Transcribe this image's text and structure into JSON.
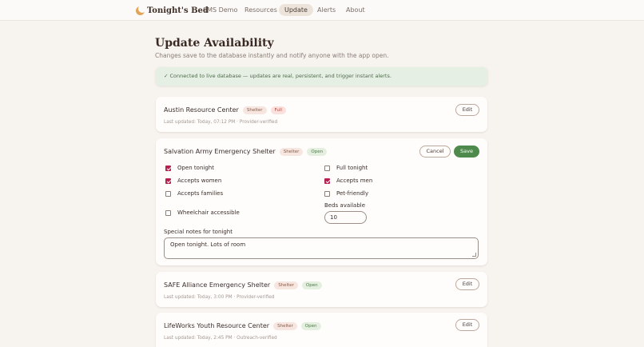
{
  "nav": {
    "brand": "Tonight's Bed",
    "items": [
      "SMS Demo",
      "Resources",
      "Update",
      "Alerts",
      "About"
    ],
    "active": "Update"
  },
  "page": {
    "title": "Update Availability",
    "subtitle": "Changes save to the database instantly and notify anyone with the app open."
  },
  "banner": {
    "text": "✓ Connected to live database — updates are real, persistent, and trigger instant alerts."
  },
  "cards": [
    {
      "name": "Austin Resource Center",
      "type": "Shelter",
      "status": "Full",
      "meta": "Last updated: Today, 07:12 PM · Provider-verified",
      "edit_label": "Edit"
    },
    {
      "name": "Salvation Army Emergency Shelter",
      "type": "Shelter",
      "status": "Open",
      "cancel_label": "Cancel",
      "save_label": "Save",
      "checkboxes": [
        {
          "label": "Open tonight",
          "checked": true
        },
        {
          "label": "Full tonight",
          "checked": false
        },
        {
          "label": "Accepts women",
          "checked": true
        },
        {
          "label": "Accepts men",
          "checked": true
        },
        {
          "label": "Accepts families",
          "checked": false
        },
        {
          "label": "Pet-friendly",
          "checked": false
        },
        {
          "label": "Wheelchair accessible",
          "checked": false
        }
      ],
      "beds_label": "Beds available",
      "beds_value": "10",
      "notes_label": "Special notes for tonight",
      "notes_value": "Open tonight. Lots of room"
    },
    {
      "name": "SAFE Alliance Emergency Shelter",
      "type": "Shelter",
      "status": "Open",
      "meta": "Last updated: Today, 3:00 PM · Provider-verified",
      "edit_label": "Edit"
    },
    {
      "name": "LifeWorks Youth Resource Center",
      "type": "Shelter",
      "status": "Open",
      "meta": "Last updated: Today, 2:45 PM · Outreach-verified",
      "edit_label": "Edit"
    }
  ],
  "colors": {
    "accent_green": "#4e8a4b",
    "checkbox_checked": "#b5204f",
    "background": "#f7f3ee"
  }
}
